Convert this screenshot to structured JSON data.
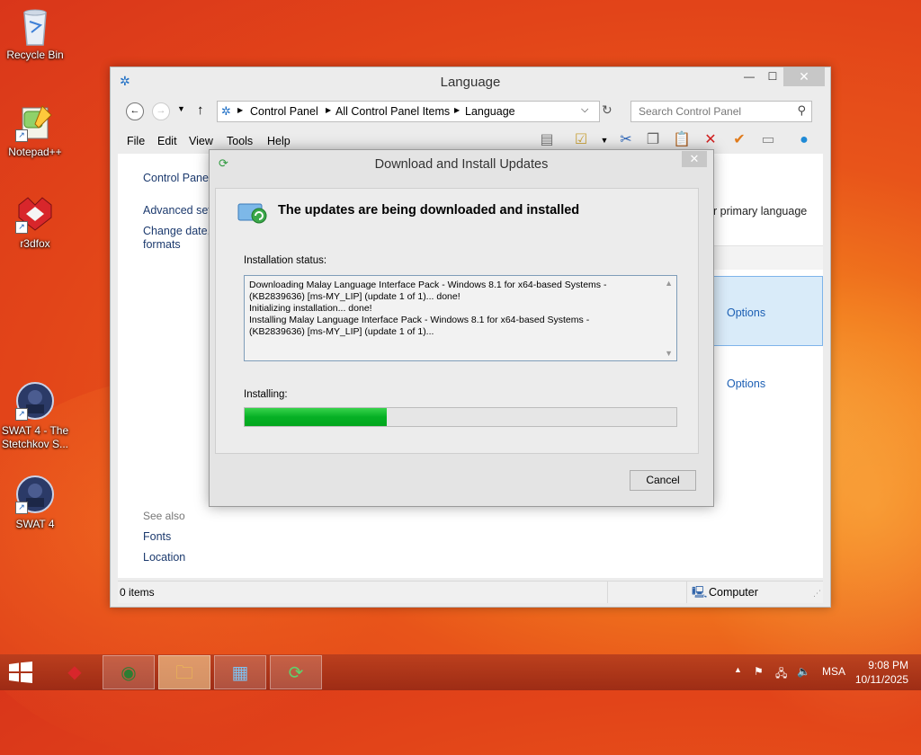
{
  "desktop": {
    "icons": [
      {
        "label": "Recycle Bin"
      },
      {
        "label": "Notepad++"
      },
      {
        "label": "r3dfox"
      },
      {
        "label": "SWAT 4 - The Stetchkov S..."
      },
      {
        "label": "SWAT 4"
      }
    ]
  },
  "window": {
    "title": "Language",
    "address": {
      "crumbs": [
        "Control Panel",
        "All Control Panel Items",
        "Language"
      ],
      "search_placeholder": "Search Control Panel"
    },
    "menu": [
      "File",
      "Edit",
      "View",
      "Tools",
      "Help"
    ],
    "left_links": {
      "home": "Control Panel",
      "advanced": "Advanced sett",
      "change_date_line1": "Change date,",
      "change_date_line2": "formats"
    },
    "right_text": "r primary language",
    "options": [
      "Options",
      "Options"
    ],
    "see_also": {
      "heading": "See also",
      "links": [
        "Fonts",
        "Location"
      ]
    },
    "status": {
      "items": "0 items",
      "location": "Computer"
    }
  },
  "dialog": {
    "title": "Download and Install Updates",
    "heading": "The updates are being downloaded and installed",
    "status_label": "Installation status:",
    "log": "Downloading Malay Language Interface Pack - Windows 8.1 for x64-based Systems -\n(KB2839636) [ms-MY_LIP] (update 1 of 1)... done!\nInitializing installation... done!\nInstalling Malay Language Interface Pack - Windows 8.1 for x64-based Systems -\n(KB2839636) [ms-MY_LIP] (update 1 of 1)...",
    "progress_label": "Installing:",
    "progress_fraction": 0.33,
    "cancel_label": "Cancel"
  },
  "taskbar": {
    "language": "MSA",
    "time": "9:08 PM",
    "date": "10/11/2025"
  }
}
